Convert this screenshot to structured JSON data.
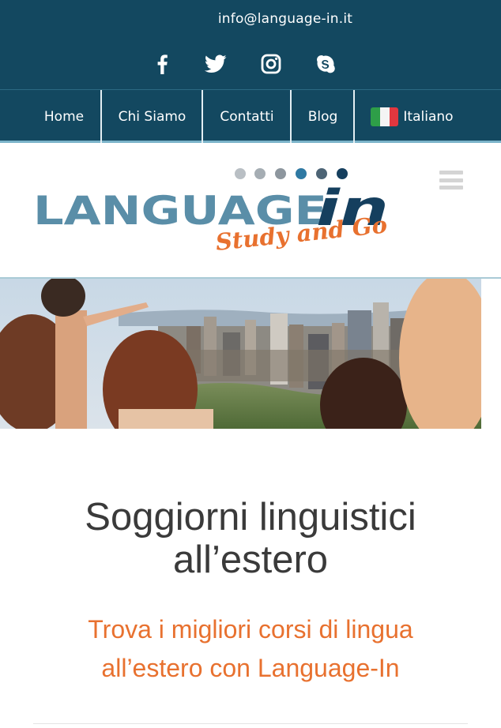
{
  "topbar": {
    "email": "info@language-in.it",
    "social": [
      {
        "icon": "facebook-icon"
      },
      {
        "icon": "twitter-icon"
      },
      {
        "icon": "instagram-icon"
      },
      {
        "icon": "skype-icon"
      }
    ]
  },
  "nav": {
    "items": [
      {
        "label": "Home"
      },
      {
        "label": "Chi Siamo"
      },
      {
        "label": "Contatti"
      },
      {
        "label": "Blog"
      },
      {
        "label": "Italiano",
        "icon": "italy-flag-icon"
      }
    ]
  },
  "logo": {
    "wordmark": "LANGUAGE",
    "suffix": "in",
    "tagline": "Study and Go"
  },
  "hero": {
    "alt": "hero-photo"
  },
  "content": {
    "headline_line1": "Soggiorni linguistici",
    "headline_line2": "all’estero",
    "subhead_line1": "Trova i migliori corsi di lingua",
    "subhead_line2": "all’estero con Language-In"
  },
  "colors": {
    "topbar_bg": "#134860",
    "accent_orange": "#e8712f",
    "logo_teal": "#5a8ea8",
    "logo_navy": "#153f5e",
    "text_dark": "#3a3a3a"
  }
}
